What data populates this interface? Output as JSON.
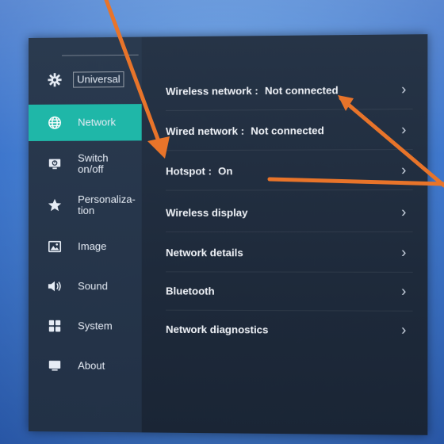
{
  "sidebar": {
    "items": [
      {
        "label": "Universal",
        "icon": "gear-icon"
      },
      {
        "label": "Network",
        "icon": "globe-icon",
        "active": true
      },
      {
        "label": "Switch\non/off",
        "icon": "power-monitor-icon"
      },
      {
        "label": "Personaliza-\ntion",
        "icon": "star-icon"
      },
      {
        "label": "Image",
        "icon": "image-icon"
      },
      {
        "label": "Sound",
        "icon": "speaker-icon"
      },
      {
        "label": "System",
        "icon": "grid-icon"
      },
      {
        "label": "About",
        "icon": "monitor-icon"
      }
    ]
  },
  "content": {
    "rows": [
      {
        "label": "Wireless network :",
        "value": "Not connected"
      },
      {
        "label": "Wired network :",
        "value": "Not connected"
      },
      {
        "label": "Hotspot :",
        "value": "On"
      },
      {
        "label": "Wireless display",
        "value": ""
      },
      {
        "label": "Network details",
        "value": ""
      },
      {
        "label": "Bluetooth",
        "value": ""
      },
      {
        "label": "Network diagnostics",
        "value": ""
      }
    ],
    "chevron": "›"
  },
  "colors": {
    "accent": "#1fb7a8",
    "annotation_arrow": "#e8742a",
    "background": "#4b86d6"
  }
}
